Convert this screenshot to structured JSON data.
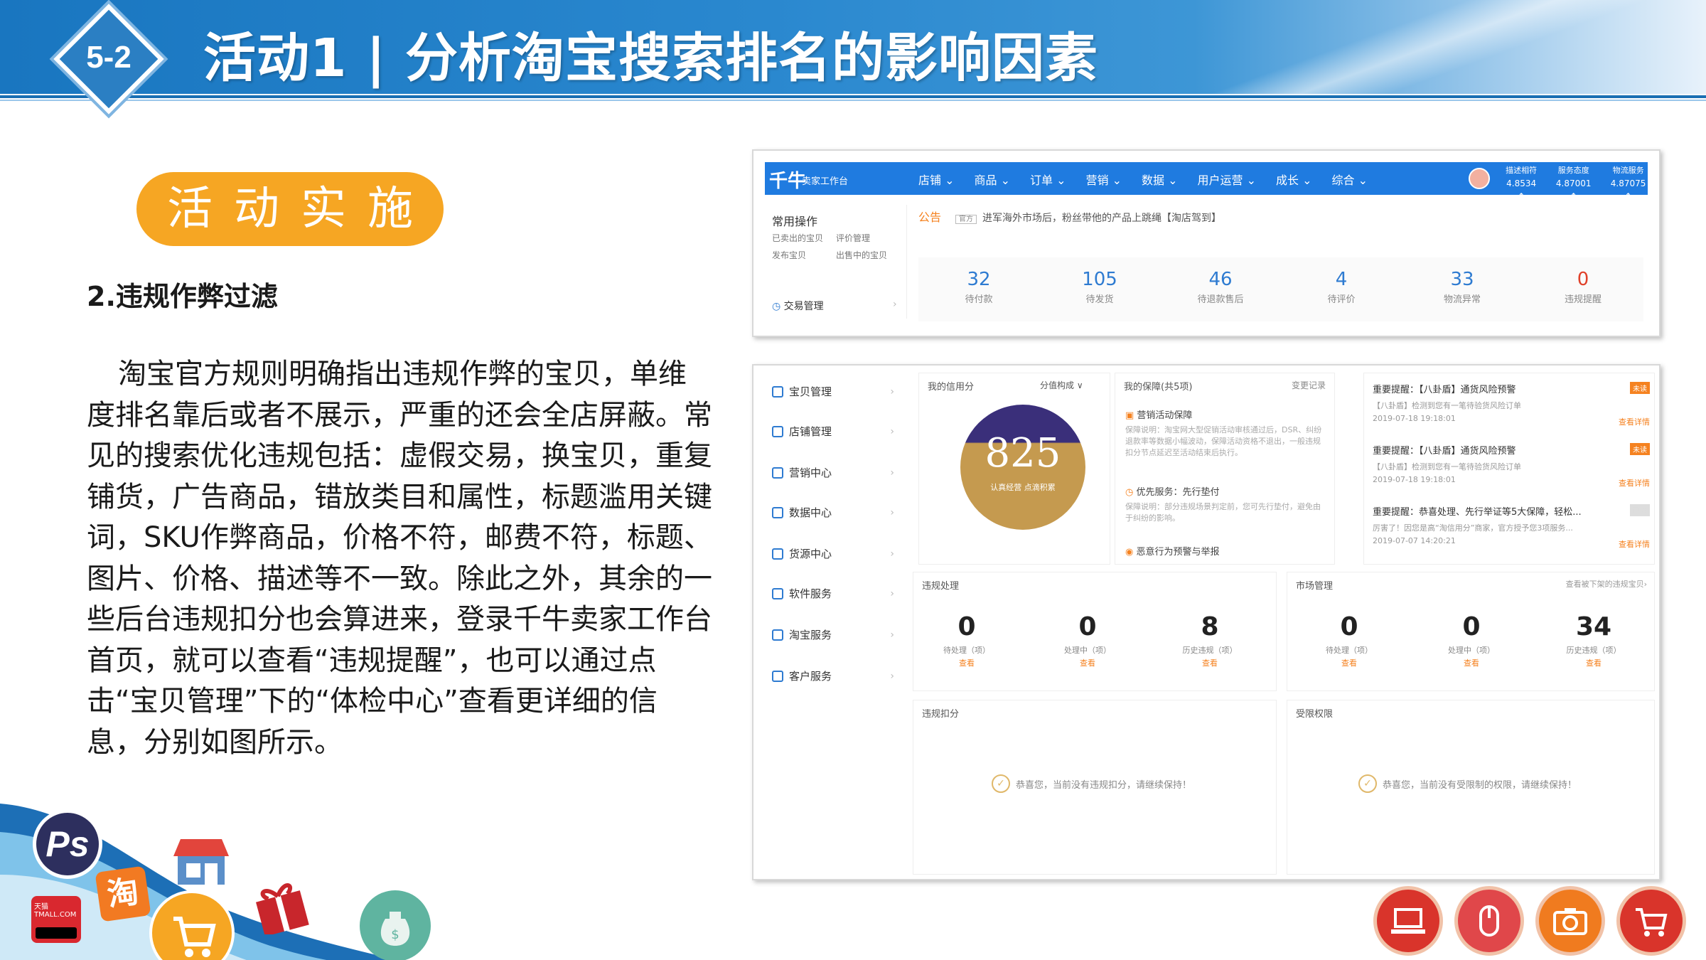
{
  "header": {
    "badge": "5-2",
    "title": "活动1 | 分析淘宝搜索排名的影响因素"
  },
  "left": {
    "pill": "活动实施",
    "subhead": "2.违规作弊过滤",
    "paragraph": "淘宝官方规则明确指出违规作弊的宝贝，单维度排名靠后或者不展示，严重的还会全店屏蔽。常见的搜索优化违规包括：虚假交易，换宝贝，重复铺货，广告商品，错放类目和属性，标题滥用关键词，SKU作弊商品，价格不符，邮费不符，标题、图片、价格、描述等不一致。除此之外，其余的一些后台违规扣分也会算进来，登录千牛卖家工作台首页，就可以查看“违规提醒”，也可以通过点击“宝贝管理”下的“体检中心”查看更详细的信息，分别如图所示。"
  },
  "shot1": {
    "logo": "千牛",
    "logo_sub": "卖家工作台",
    "menu": [
      "店铺 ⌄",
      "商品 ⌄",
      "订单 ⌄",
      "营销 ⌄",
      "数据 ⌄",
      "用户运营 ⌄",
      "成长 ⌄",
      "综合 ⌄"
    ],
    "scores": [
      {
        "label": "描述相符",
        "value": "4.8534 ↑"
      },
      {
        "label": "服务态度",
        "value": "4.87001 ↑"
      },
      {
        "label": "物流服务",
        "value": "4.87075 ↑"
      }
    ],
    "ops_title": "常用操作",
    "ops_links": [
      "已卖出的宝贝",
      "评价管理",
      "发布宝贝",
      "出售中的宝贝"
    ],
    "ops_trade": "交易管理",
    "notice_tag": "公告",
    "notice_mini": "官方",
    "notice_text": "进军海外市场后，粉丝带他的产品上跳绳【淘店驾到】",
    "stats": [
      {
        "n": "32",
        "c": "待付款"
      },
      {
        "n": "105",
        "c": "待发货"
      },
      {
        "n": "46",
        "c": "待退款售后"
      },
      {
        "n": "4",
        "c": "待评价"
      },
      {
        "n": "33",
        "c": "物流异常"
      },
      {
        "n": "0",
        "c": "违规提醒"
      }
    ]
  },
  "shot2": {
    "side": [
      "宝贝管理",
      "店铺管理",
      "营销中心",
      "数据中心",
      "货源中心",
      "软件服务",
      "淘宝服务",
      "客户服务"
    ],
    "credit_title": "我的信用分",
    "credit_kind": "分值构成 ∨",
    "credit_score": "825",
    "credit_label": "认真经营 点滴积累",
    "protect_title": "我的保障(共5项)",
    "protect_record": "变更记录",
    "protect_items": [
      {
        "t": "营销活动保障",
        "d": "保障说明：淘宝网大型促销活动审核通过后，DSR、纠纷退款率等数据小幅波动，保障活动资格不退出，一般违规扣分节点延迟至活动结束后执行。"
      },
      {
        "t": "优先服务：先行垫付",
        "d": "保障说明：部分违规场景判定前，您可先行垫付，避免由于纠纷的影响。"
      },
      {
        "t": "恶意行为预警与举报",
        "d": ""
      }
    ],
    "notes": [
      {
        "t": "重要提醒：【八卦盾】通货风险预警",
        "d": "【八卦盾】检测到您有一笔待验货风险订单",
        "dt": "2019-07-18 19:18:01",
        "lnk": "查看详情",
        "flag": "未读"
      },
      {
        "t": "重要提醒：【八卦盾】通货风险预警",
        "d": "【八卦盾】检测到您有一笔待验货风险订单",
        "dt": "2019-07-18 19:18:01",
        "lnk": "查看详情",
        "flag": "未读"
      },
      {
        "t": "重要提醒：恭喜处理、先行举证等5大保障，轻松...",
        "d": "厉害了！因您是高“淘信用分”商家，官方授予您3项服务...",
        "dt": "2019-07-07 14:20:21",
        "lnk": "查看详情",
        "flag": "已读"
      }
    ],
    "violation_title": "违规处理",
    "market_title": "市场管理",
    "market_link": "查看被下架的违规宝贝›",
    "violation_metrics": [
      {
        "n": "0",
        "c": "待处理（项）",
        "a": "查看"
      },
      {
        "n": "0",
        "c": "处理中（项）",
        "a": "查看"
      },
      {
        "n": "8",
        "c": "历史违规（项）",
        "a": "查看"
      }
    ],
    "market_metrics": [
      {
        "n": "0",
        "c": "待处理（项）",
        "a": "查看"
      },
      {
        "n": "0",
        "c": "处理中（项）",
        "a": "查看"
      },
      {
        "n": "34",
        "c": "历史违规（项）",
        "a": "查看"
      }
    ],
    "deduct_title": "违规扣分",
    "deduct_ok": "恭喜您，当前没有违规扣分，请继续保持！",
    "limit_title": "受限权限",
    "limit_ok": "恭喜您，当前没有受限制的权限，请继续保持！"
  },
  "deco": {
    "ps": "Ps",
    "tao": "淘",
    "tmall": "天猫 TMALL.COM",
    "icons": [
      "ps-icon",
      "taobao-icon",
      "tmall-icon",
      "shop-icon",
      "cart-icon",
      "gift-icon",
      "money-bag-icon",
      "laptop-icon",
      "mouse-icon",
      "camera-icon",
      "shopping-cart-icon"
    ],
    "colors": {
      "blue": "#1f7be0",
      "orange": "#f6a623",
      "red": "#d9282f",
      "button_red": "#d9342b"
    }
  }
}
